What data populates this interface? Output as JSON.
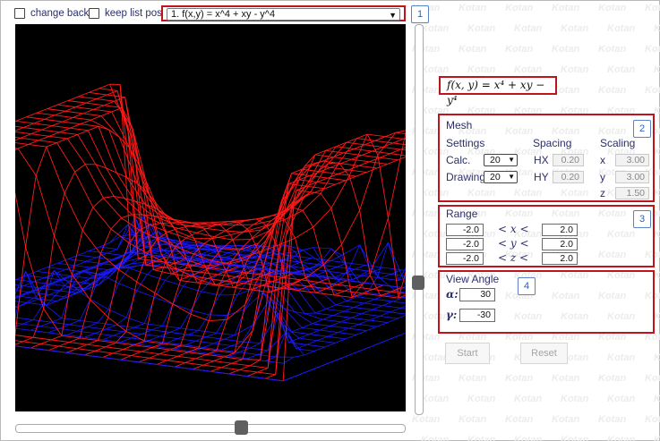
{
  "toolbar": {
    "change_back_label": "change back",
    "keep_list_label": "keep list pos.",
    "function_select_value": "1. f(x,y) = x^4 + xy - y^4"
  },
  "badges": {
    "b1": "1",
    "b2": "2",
    "b3": "3",
    "b4": "4"
  },
  "formula": "f(x, y) = x⁴ + xy − y⁴",
  "watermark_text": "Kotan",
  "mesh": {
    "title": "Mesh",
    "settings_header": "Settings",
    "spacing_header": "Spacing",
    "scaling_header": "Scaling",
    "calc_label": "Calc.",
    "calc_value": "20",
    "drawing_label": "Drawing",
    "drawing_value": "20",
    "hx_label": "HX",
    "hx_value": "0.20",
    "hy_label": "HY",
    "hy_value": "0.20",
    "x_label": "x",
    "x_value": "3.00",
    "y_label": "y",
    "y_value": "3.00",
    "z_label": "z",
    "z_value": "1.50"
  },
  "range": {
    "title": "Range",
    "x_min": "-2.0",
    "x_max": "2.0",
    "x_label": "< x <",
    "y_min": "-2.0",
    "y_max": "2.0",
    "y_label": "< y <",
    "z_min": "-2.0",
    "z_max": "2.0",
    "z_label": "< z <"
  },
  "view": {
    "title": "View Angle",
    "alpha_label": "α:",
    "alpha_value": "30",
    "gamma_label": "γ:",
    "gamma_value": "-30"
  },
  "buttons": {
    "start": "Start",
    "reset": "Reset"
  },
  "colors": {
    "accent_red": "#c0141c",
    "mesh_red": "#ff1a1a",
    "mesh_blue": "#1a1aff",
    "canvas_bg": "#000000"
  }
}
